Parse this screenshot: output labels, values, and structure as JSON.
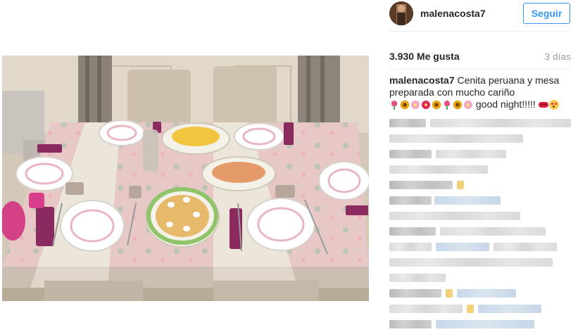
{
  "post": {
    "username": "malenacosta7",
    "follow_label": "Seguir",
    "likes": "3.930 Me gusta",
    "time_ago": "3 días",
    "caption": {
      "author": "malenacosta7",
      "text": "Cenita peruana y mesa preparada con mucho cariño",
      "emojis": [
        "tulip-emoji",
        "sunflower-emoji",
        "blossom-emoji",
        "hibiscus-emoji",
        "sunflower-emoji",
        "tulip-emoji",
        "sunflower-emoji",
        "blossom-emoji"
      ],
      "trailing_text": "good night!!!!!",
      "trailing_emojis": [
        "kiss-mark-emoji",
        "heart-eyes-emoji"
      ]
    }
  },
  "colors": {
    "accent": "#3897f0",
    "text": "#262626",
    "muted": "#999999",
    "divider": "#efefef"
  }
}
